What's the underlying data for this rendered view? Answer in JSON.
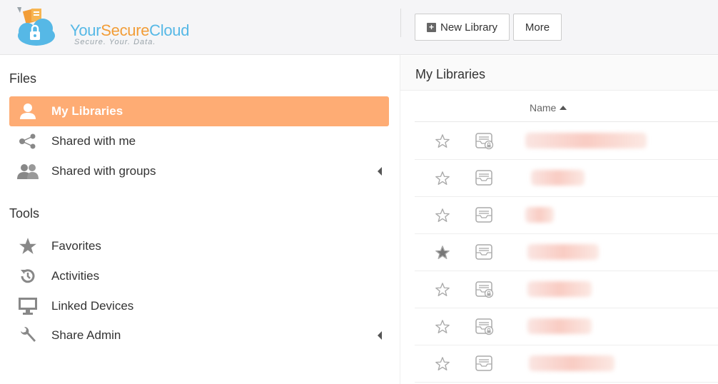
{
  "brand": {
    "name_part1": "Your",
    "name_part2": "Secure",
    "name_part3": "Cloud",
    "tagline": "Secure. Your. Data."
  },
  "toolbar": {
    "new_library": "New Library",
    "more": "More"
  },
  "sidebar": {
    "files_title": "Files",
    "files_items": [
      {
        "label": "My Libraries",
        "icon": "user-icon",
        "active": true
      },
      {
        "label": "Shared with me",
        "icon": "share-icon"
      },
      {
        "label": "Shared with groups",
        "icon": "group-icon",
        "expandable": true
      }
    ],
    "tools_title": "Tools",
    "tools_items": [
      {
        "label": "Favorites",
        "icon": "star-icon"
      },
      {
        "label": "Activities",
        "icon": "history-icon"
      },
      {
        "label": "Linked Devices",
        "icon": "monitor-icon"
      },
      {
        "label": "Share Admin",
        "icon": "wrench-icon",
        "expandable": true
      }
    ]
  },
  "main": {
    "title": "My Libraries",
    "column_name": "Name",
    "rows": [
      {
        "starred": false,
        "encrypted": true
      },
      {
        "starred": false,
        "encrypted": false
      },
      {
        "starred": false,
        "encrypted": false
      },
      {
        "starred": true,
        "encrypted": false
      },
      {
        "starred": false,
        "encrypted": true
      },
      {
        "starred": false,
        "encrypted": true
      },
      {
        "starred": false,
        "encrypted": false
      }
    ]
  },
  "colors": {
    "active_bg": "#feac74",
    "brand_blue": "#56b8e6",
    "brand_orange": "#f29d38"
  }
}
